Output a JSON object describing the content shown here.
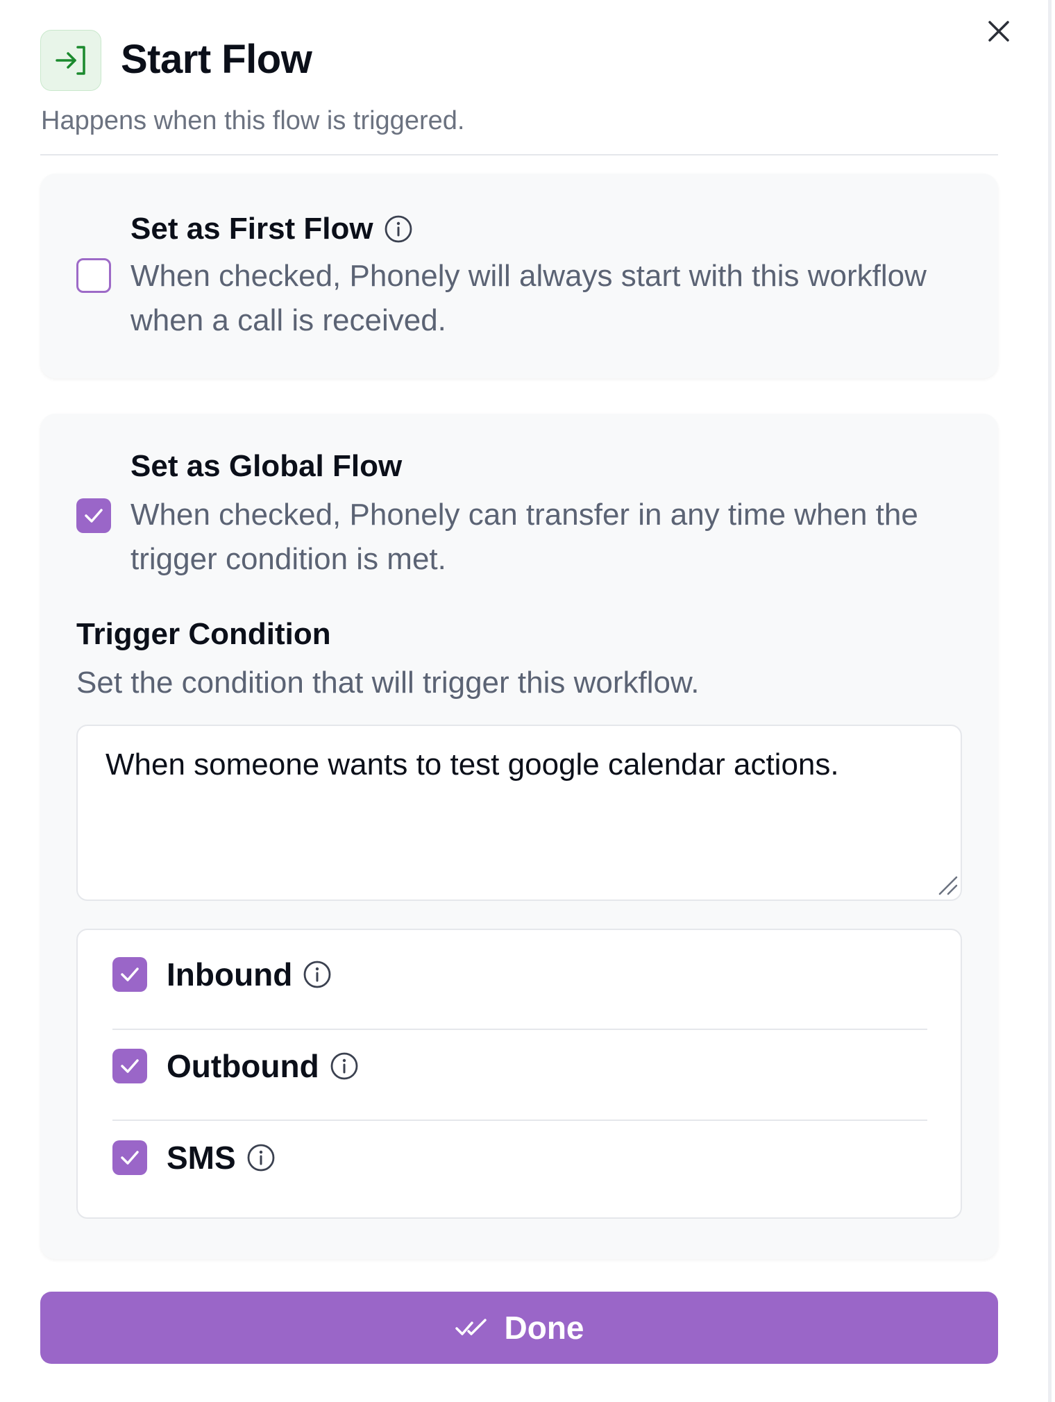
{
  "header": {
    "title": "Start Flow",
    "subtitle": "Happens when this flow is triggered.",
    "icon": "enter-flow-icon",
    "icon_color": "#1b8a2e"
  },
  "first_flow": {
    "label": "Set as First Flow",
    "description": "When checked, Phonely will always start with this workflow when a call is received.",
    "checked": false
  },
  "global_flow": {
    "label": "Set as Global Flow",
    "description": "When checked, Phonely can transfer in any time when the trigger condition is met.",
    "checked": true
  },
  "trigger": {
    "title": "Trigger Condition",
    "description": "Set the condition that will trigger this workflow.",
    "value": "When someone wants to test google calendar actions."
  },
  "channels": [
    {
      "label": "Inbound",
      "checked": true
    },
    {
      "label": "Outbound",
      "checked": true
    },
    {
      "label": "SMS",
      "checked": true
    }
  ],
  "done_button": {
    "label": "Done",
    "icon": "double-check-icon"
  },
  "colors": {
    "accent": "#9a66c8",
    "muted_text": "#5b6374",
    "card_bg": "#f8f9fa"
  }
}
